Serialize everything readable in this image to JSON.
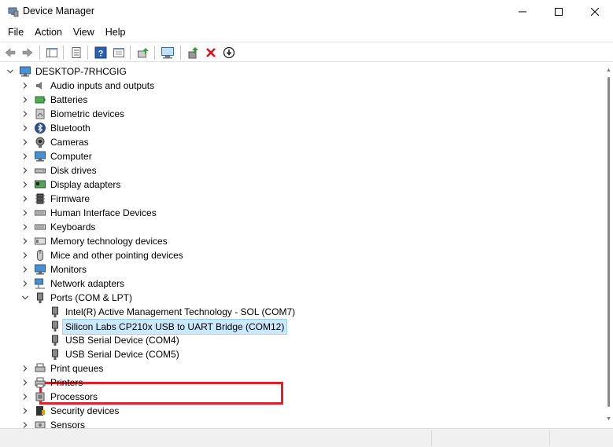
{
  "window": {
    "title": "Device Manager"
  },
  "menu": [
    "File",
    "Action",
    "View",
    "Help"
  ],
  "toolbar": {
    "buttons": [
      "back-icon",
      "forward-icon",
      "show-hide-tree-icon",
      "properties-icon",
      "help-icon",
      "view-icon",
      "update-driver-icon",
      "scan-hardware-icon",
      "add-legacy-icon",
      "uninstall-icon",
      "disable-device-icon"
    ]
  },
  "tree": {
    "root": "DESKTOP-7RHCGIG",
    "categories": [
      {
        "label": "Audio inputs and outputs",
        "icon": "speaker-icon",
        "expanded": false
      },
      {
        "label": "Batteries",
        "icon": "battery-icon",
        "expanded": false
      },
      {
        "label": "Biometric devices",
        "icon": "fingerprint-icon",
        "expanded": false
      },
      {
        "label": "Bluetooth",
        "icon": "bluetooth-icon",
        "expanded": false
      },
      {
        "label": "Cameras",
        "icon": "camera-icon",
        "expanded": false
      },
      {
        "label": "Computer",
        "icon": "computer-icon",
        "expanded": false
      },
      {
        "label": "Disk drives",
        "icon": "disk-drive-icon",
        "expanded": false
      },
      {
        "label": "Display adapters",
        "icon": "display-adapter-icon",
        "expanded": false
      },
      {
        "label": "Firmware",
        "icon": "firmware-icon",
        "expanded": false
      },
      {
        "label": "Human Interface Devices",
        "icon": "hid-icon",
        "expanded": false
      },
      {
        "label": "Keyboards",
        "icon": "keyboard-icon",
        "expanded": false
      },
      {
        "label": "Memory technology devices",
        "icon": "memory-icon",
        "expanded": false
      },
      {
        "label": "Mice and other pointing devices",
        "icon": "mouse-icon",
        "expanded": false
      },
      {
        "label": "Monitors",
        "icon": "monitor-icon",
        "expanded": false
      },
      {
        "label": "Network adapters",
        "icon": "network-icon",
        "expanded": false
      },
      {
        "label": "Ports (COM & LPT)",
        "icon": "port-icon",
        "expanded": true
      },
      {
        "label": "Print queues",
        "icon": "print-queue-icon",
        "expanded": false
      },
      {
        "label": "Printers",
        "icon": "printer-icon",
        "expanded": false
      },
      {
        "label": "Processors",
        "icon": "processor-icon",
        "expanded": false
      },
      {
        "label": "Security devices",
        "icon": "security-icon",
        "expanded": false
      },
      {
        "label": "Sensors",
        "icon": "sensor-icon",
        "expanded": false
      }
    ],
    "ports_children": [
      {
        "label": "Intel(R) Active Management Technology - SOL (COM7)",
        "selected": false
      },
      {
        "label": "Silicon Labs CP210x USB to UART Bridge (COM12)",
        "selected": true
      },
      {
        "label": "USB Serial Device (COM4)",
        "selected": false
      },
      {
        "label": "USB Serial Device (COM5)",
        "selected": false
      }
    ]
  },
  "colors": {
    "selection_bg": "#cce8ff",
    "selection_border": "#99d1ff",
    "highlight_box": "#e0202c"
  }
}
